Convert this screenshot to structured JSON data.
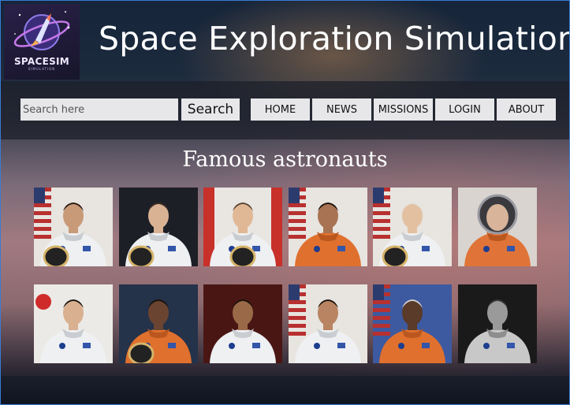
{
  "header": {
    "logo_text": "SPACESIM",
    "logo_subtext": "SIMULATION",
    "title": "Space Exploration Simulation"
  },
  "search": {
    "placeholder": "Search here",
    "button_label": "Search"
  },
  "nav": {
    "items": [
      {
        "label": "HOME"
      },
      {
        "label": "NEWS"
      },
      {
        "label": "MISSIONS"
      },
      {
        "label": "LOGIN"
      },
      {
        "label": "ABOUT"
      }
    ]
  },
  "gallery": {
    "heading": "Famous astronauts",
    "photos": [
      {
        "suit": "white",
        "bg": "flag-us",
        "skin": "#c99a78",
        "hair": "#2a1a12",
        "icon": "astronaut-photo-icon"
      },
      {
        "suit": "white",
        "bg": "dark",
        "skin": "#d9b294",
        "hair": "#3a2d24",
        "icon": "astronaut-photo-icon"
      },
      {
        "suit": "white",
        "bg": "flag-ca",
        "skin": "#e0b896",
        "hair": "#5a4634",
        "icon": "astronaut-photo-icon"
      },
      {
        "suit": "orange",
        "bg": "flag-us",
        "skin": "#a87352",
        "hair": "#1a120c",
        "icon": "astronaut-photo-icon"
      },
      {
        "suit": "white",
        "bg": "flag-us",
        "skin": "#e2c0a0",
        "hair": "#e4e0d8",
        "icon": "astronaut-photo-icon"
      },
      {
        "suit": "orange-helmet",
        "bg": "light",
        "skin": "#d8b49a",
        "hair": "#6a4a34",
        "icon": "astronaut-photo-icon"
      },
      {
        "suit": "white",
        "bg": "flag-jp",
        "skin": "#d9b090",
        "hair": "#1a1410",
        "icon": "astronaut-photo-icon"
      },
      {
        "suit": "orange",
        "bg": "dark-blue",
        "skin": "#6a4430",
        "hair": "#1a100c",
        "icon": "astronaut-photo-icon"
      },
      {
        "suit": "white",
        "bg": "dark-red",
        "skin": "#9a6a48",
        "hair": "#1a120c",
        "icon": "astronaut-photo-icon"
      },
      {
        "suit": "white",
        "bg": "flag-us",
        "skin": "#b88462",
        "hair": "#1a120c",
        "icon": "astronaut-photo-icon"
      },
      {
        "suit": "orange",
        "bg": "flag-us-blue",
        "skin": "#5a3a28",
        "hair": "#cfcfcf",
        "icon": "astronaut-photo-icon"
      },
      {
        "suit": "silver",
        "bg": "bw",
        "skin": "#9a9a9a",
        "hair": "#3a3a3a",
        "icon": "astronaut-photo-icon"
      }
    ]
  },
  "colors": {
    "nav_button_bg": "#e7e7e9",
    "nav_band": "#1c1e28",
    "title_text": "#ffffff",
    "frame_border": "#3a7bd5"
  }
}
